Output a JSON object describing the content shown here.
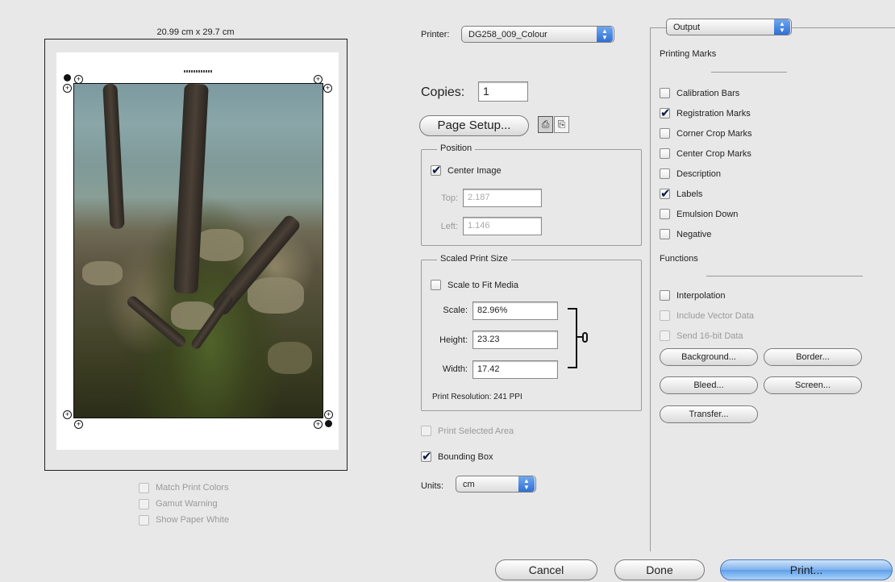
{
  "preview": {
    "paper_size": "20.99 cm x 29.7 cm",
    "options": [
      {
        "label": "Match Print Colors",
        "checked": false,
        "disabled": true
      },
      {
        "label": "Gamut Warning",
        "checked": false,
        "disabled": true
      },
      {
        "label": "Show Paper White",
        "checked": false,
        "disabled": true
      }
    ]
  },
  "printer": {
    "label": "Printer:",
    "value": "DG258_009_Colour"
  },
  "copies": {
    "label": "Copies:",
    "value": "1"
  },
  "page_setup": {
    "label": "Page Setup..."
  },
  "position": {
    "title": "Position",
    "center_image": "Center Image",
    "top_label": "Top:",
    "top_value": "2.187",
    "left_label": "Left:",
    "left_value": "1.146"
  },
  "scaled": {
    "title": "Scaled Print Size",
    "scale_to_fit": "Scale to Fit Media",
    "scale_label": "Scale:",
    "scale_value": "82.96%",
    "height_label": "Height:",
    "height_value": "23.23",
    "width_label": "Width:",
    "width_value": "17.42",
    "resolution": "Print Resolution: 241 PPI"
  },
  "print_selected_area": "Print Selected Area",
  "bounding_box": "Bounding Box",
  "units": {
    "label": "Units:",
    "value": "cm"
  },
  "output": {
    "popup_value": "Output",
    "printing_marks_title": "Printing Marks",
    "marks": [
      {
        "label": "Calibration Bars",
        "checked": false
      },
      {
        "label": "Registration Marks",
        "checked": true
      },
      {
        "label": "Corner Crop Marks",
        "checked": false
      },
      {
        "label": "Center Crop Marks",
        "checked": false
      },
      {
        "label": "Description",
        "checked": false
      },
      {
        "label": "Labels",
        "checked": true
      },
      {
        "label": "Emulsion Down",
        "checked": false
      },
      {
        "label": "Negative",
        "checked": false
      }
    ],
    "functions_title": "Functions",
    "functions": [
      {
        "label": "Interpolation",
        "checked": false,
        "disabled": false
      },
      {
        "label": "Include Vector Data",
        "checked": false,
        "disabled": true
      },
      {
        "label": "Send 16-bit Data",
        "checked": false,
        "disabled": true
      }
    ],
    "buttons": {
      "background": "Background...",
      "border": "Border...",
      "bleed": "Bleed...",
      "screen": "Screen...",
      "transfer": "Transfer..."
    }
  },
  "footer": {
    "cancel": "Cancel",
    "done": "Done",
    "print": "Print..."
  },
  "colors": {
    "accent": "#5f9fe9",
    "checkmark": "#0a1a44"
  }
}
